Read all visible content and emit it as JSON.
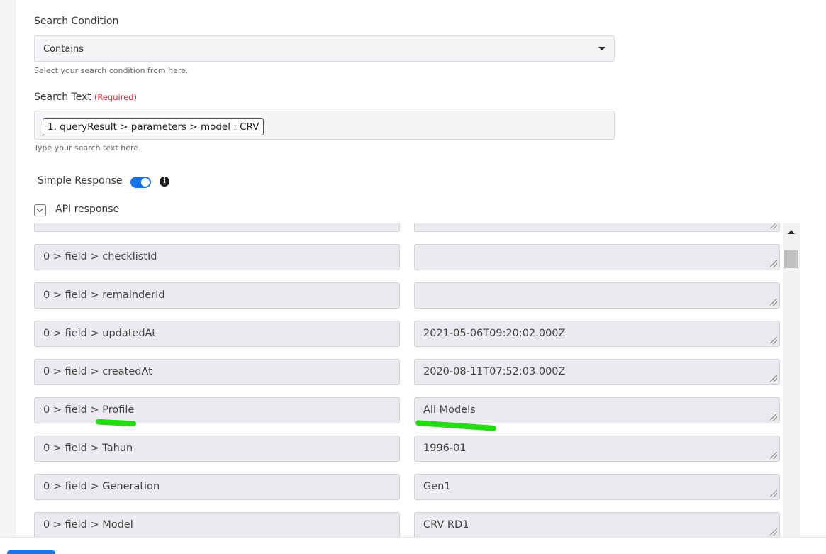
{
  "search_condition": {
    "label": "Search Condition",
    "selected": "Contains",
    "hint": "Select your search condition from here."
  },
  "search_text": {
    "label": "Search Text",
    "required": "(Required)",
    "chip": "1. queryResult > parameters > model : CRV",
    "hint": "Type your search text here."
  },
  "simple_response": {
    "label": "Simple Response",
    "enabled": true
  },
  "api_response": {
    "label": "API response",
    "rows": [
      {
        "key": "0 > field > checklistId",
        "value": ""
      },
      {
        "key": "0 > field > remainderId",
        "value": ""
      },
      {
        "key": "0 > field > updatedAt",
        "value": "2021-05-06T09:20:02.000Z"
      },
      {
        "key": "0 > field > createdAt",
        "value": "2020-08-11T07:52:03.000Z"
      },
      {
        "key": "0 > field > Profile",
        "value": "All Models"
      },
      {
        "key": "0 > field > Tahun",
        "value": "1996-01"
      },
      {
        "key": "0 > field > Generation",
        "value": "Gen1"
      },
      {
        "key": "0 > field > Model",
        "value": "CRV RD1"
      }
    ]
  },
  "icons": {
    "info": "info-icon",
    "collapse": "chevron-down-icon",
    "dropdown": "caret-down-icon",
    "scroll_up": "arrow-up-icon"
  },
  "colors": {
    "accent": "#1a73e8",
    "required": "#d7263d",
    "highlight": "#22dd10"
  }
}
